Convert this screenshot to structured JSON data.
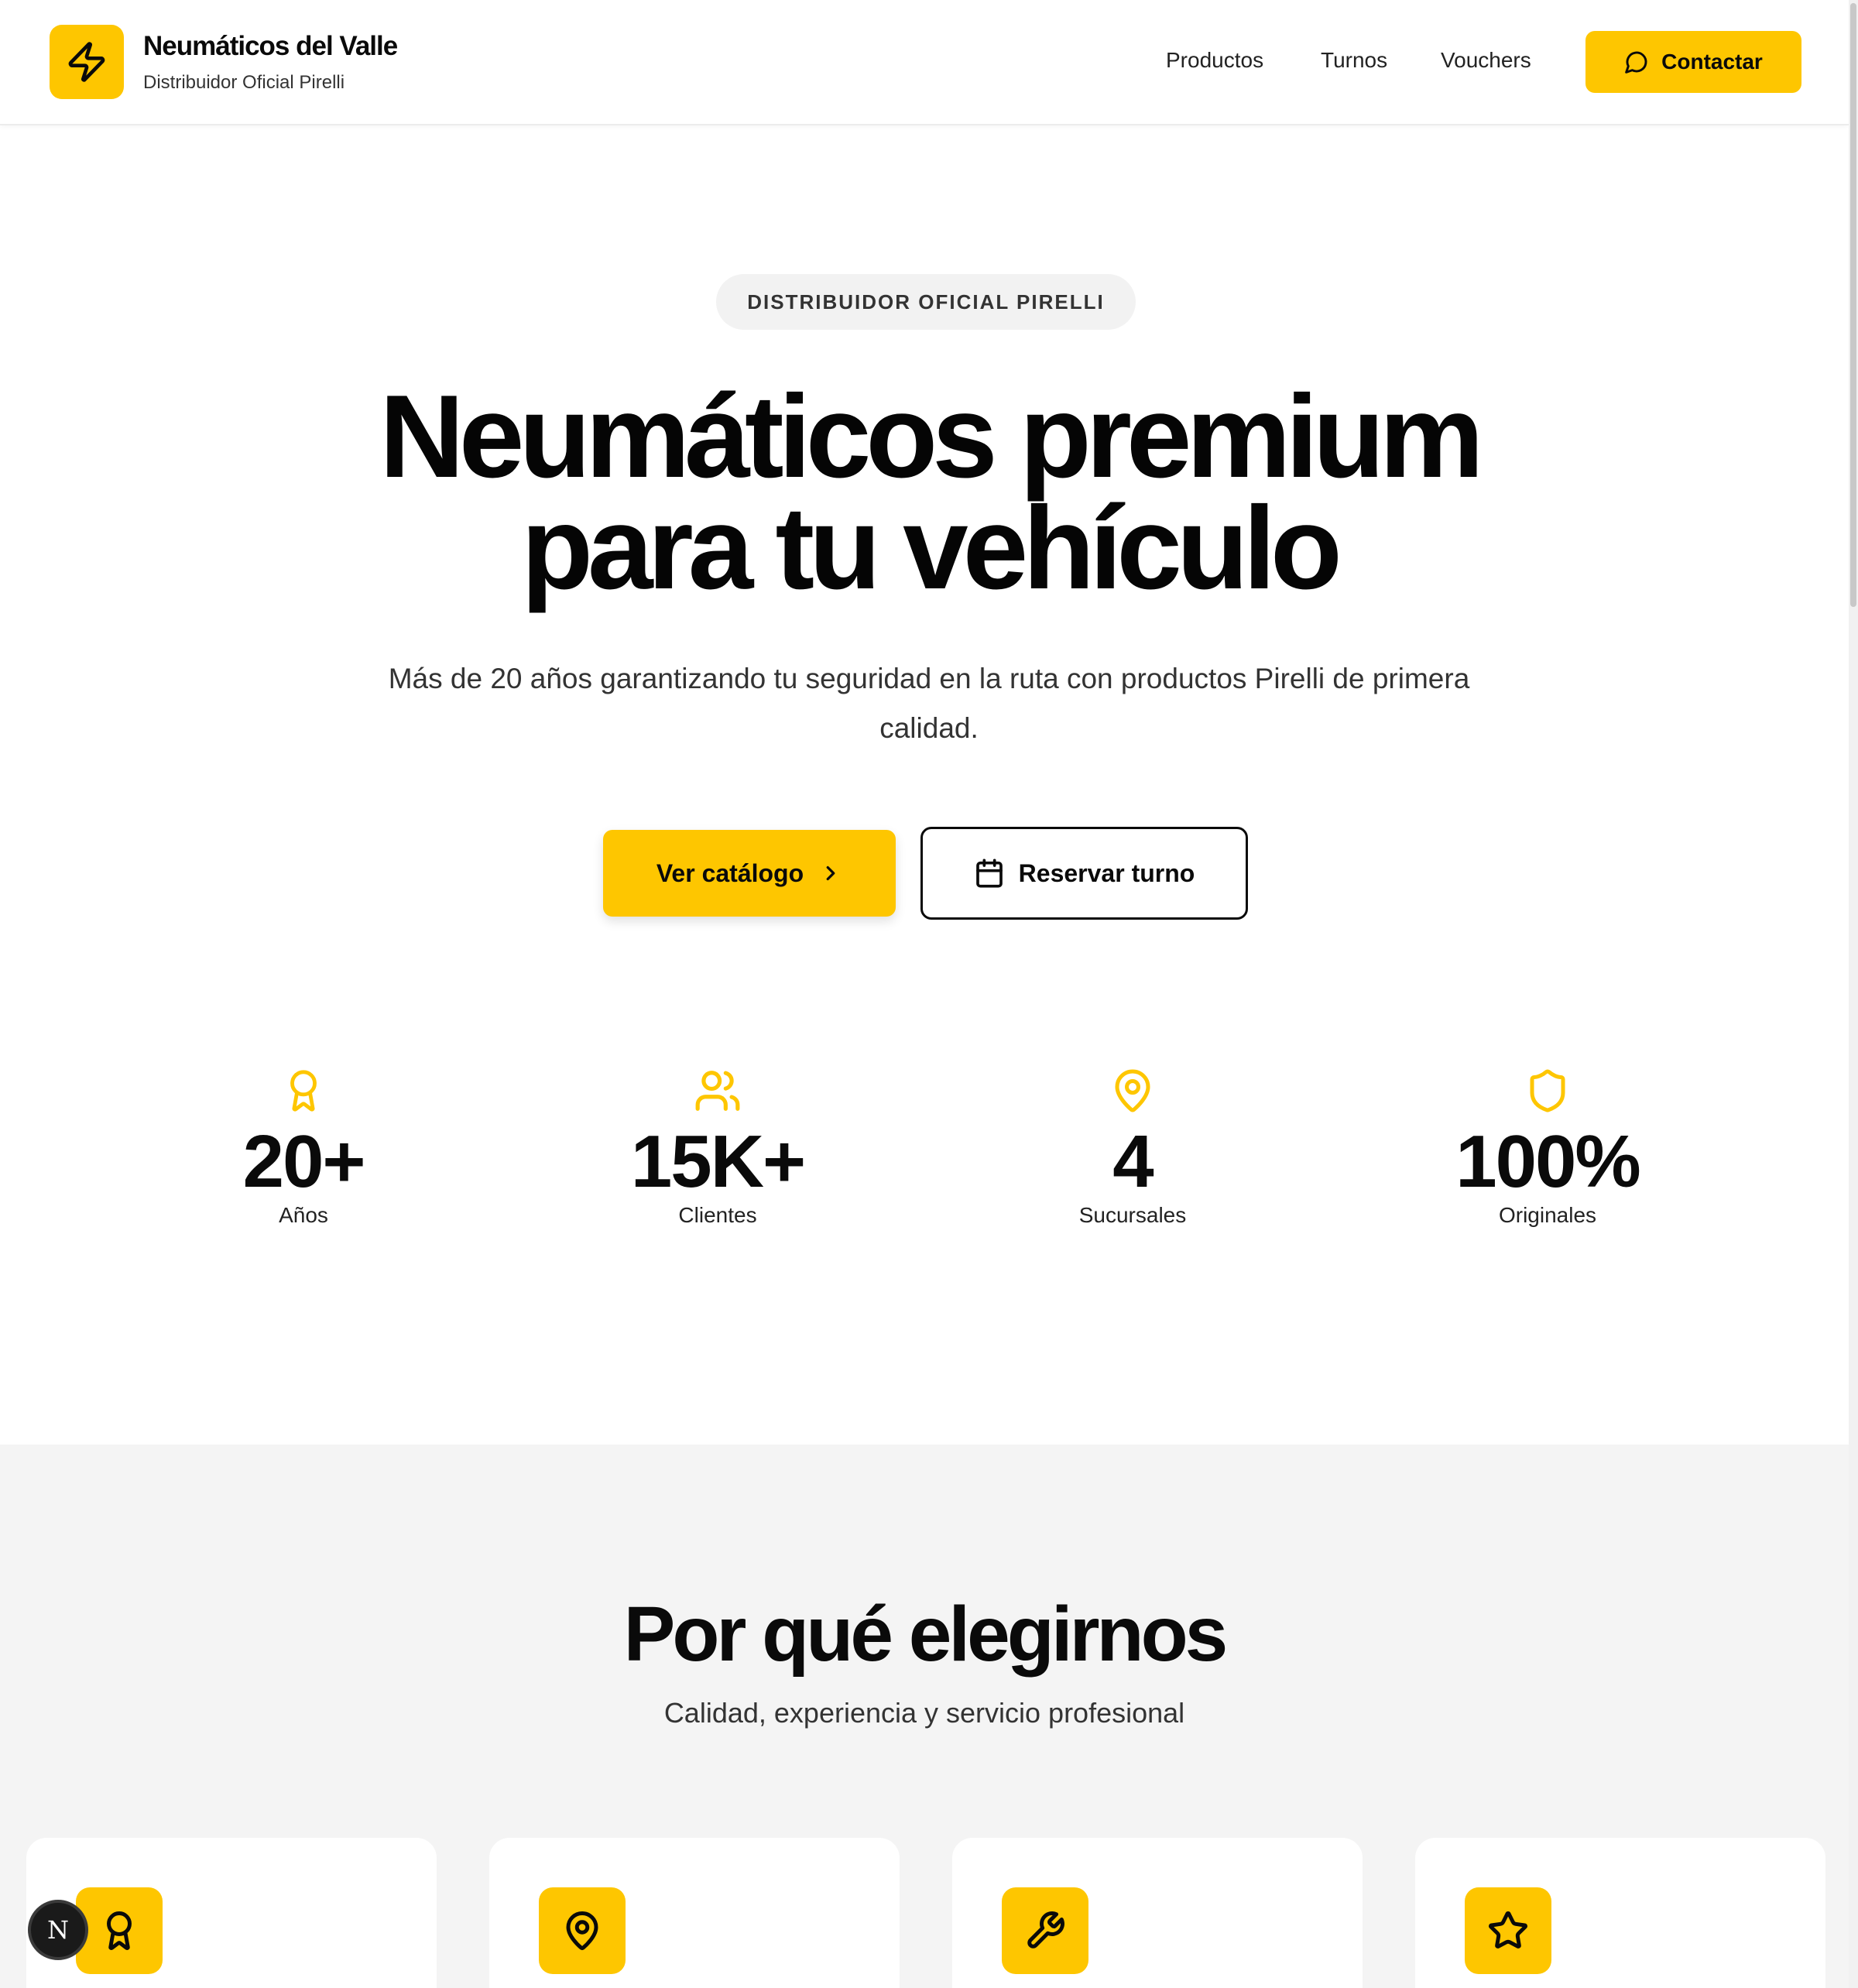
{
  "header": {
    "brand_name": "Neumáticos del Valle",
    "brand_subtitle": "Distribuidor Oficial Pirelli",
    "nav": [
      "Productos",
      "Turnos",
      "Vouchers"
    ],
    "contact_label": "Contactar",
    "logo_icon": "lightning-icon",
    "accent_color": "#FEC600"
  },
  "hero": {
    "badge": "DISTRIBUIDOR OFICIAL PIRELLI",
    "title_line1": "Neumáticos premium",
    "title_line2": "para tu vehículo",
    "subtitle": "Más de 20 años garantizando tu seguridad en la ruta con productos Pirelli de primera calidad.",
    "primary_cta": "Ver catálogo",
    "secondary_cta": "Reservar turno"
  },
  "stats": [
    {
      "icon": "award-icon",
      "value": "20+",
      "label": "Años"
    },
    {
      "icon": "users-icon",
      "value": "15K+",
      "label": "Clientes"
    },
    {
      "icon": "map-pin-icon",
      "value": "4",
      "label": "Sucursales"
    },
    {
      "icon": "shield-icon",
      "value": "100%",
      "label": "Originales"
    }
  ],
  "why": {
    "title": "Por qué elegirnos",
    "subtitle": "Calidad, experiencia y servicio profesional",
    "cards": [
      {
        "icon": "award-icon"
      },
      {
        "icon": "map-pin-icon"
      },
      {
        "icon": "wrench-icon"
      },
      {
        "icon": "star-icon"
      }
    ]
  },
  "dev_badge": "N"
}
